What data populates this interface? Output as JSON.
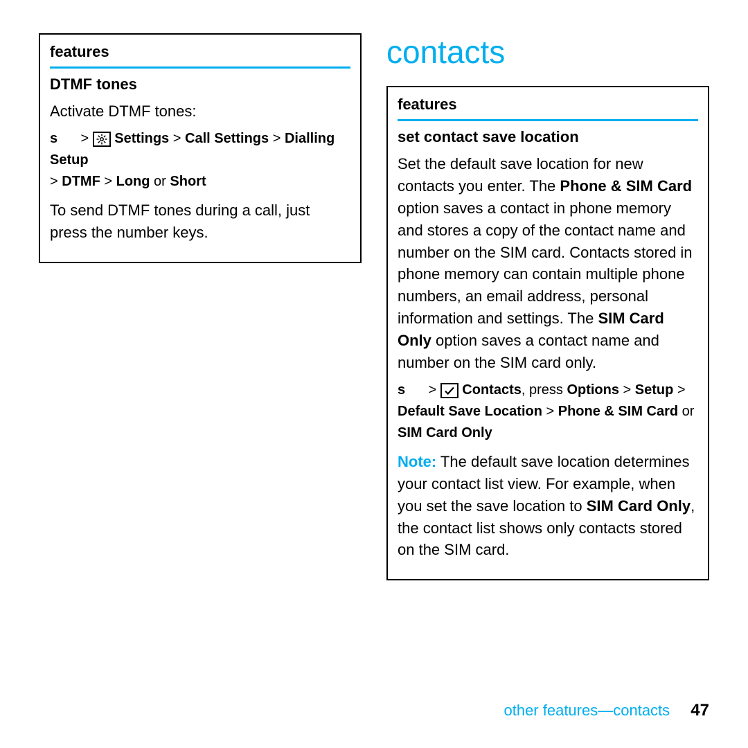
{
  "left": {
    "box_header": "features",
    "sub_title": "DTMF tones",
    "line1": "Activate DTMF tones:",
    "nav_s": "s",
    "gt": ">",
    "nav_settings": "Settings",
    "nav_call_settings": "Call Settings",
    "nav_dialling": "Dialling Setup",
    "nav_dtmf": "DTMF",
    "nav_long": "Long",
    "nav_or": "or",
    "nav_short": "Short",
    "line2": "To send DTMF tones during a call, just press the number keys."
  },
  "right": {
    "heading": "contacts",
    "box_header": "features",
    "sub_title": "set contact save location",
    "para1a": "Set the default save location for new contacts you enter. The ",
    "phone_sim": "Phone & SIM Card",
    "para1b": " option saves a contact in phone memory and stores a copy of the contact name and number on the SIM card. Contacts stored in phone memory can contain multiple phone numbers, an email address, personal information and settings. The ",
    "sim_only": "SIM Card Only",
    "para1c": " option saves a contact name and number on the SIM card only.",
    "nav_s": "s",
    "gt": ">",
    "nav_contacts": "Contacts",
    "press": ", press ",
    "nav_options": "Options",
    "nav_setup": "Setup",
    "nav_default_save": "Default Save Location",
    "nav_phone_sim": "Phone & SIM Card",
    "nav_or": "or",
    "nav_sim_only": "SIM Card Only",
    "note_label": "Note:",
    "note_a": " The default save location determines your contact list view. For example, when you set the save location to ",
    "note_sim": "SIM Card Only",
    "note_b": ", the contact list shows only contacts stored on the SIM card."
  },
  "footer": {
    "text": "other features—contacts",
    "page": "47"
  }
}
